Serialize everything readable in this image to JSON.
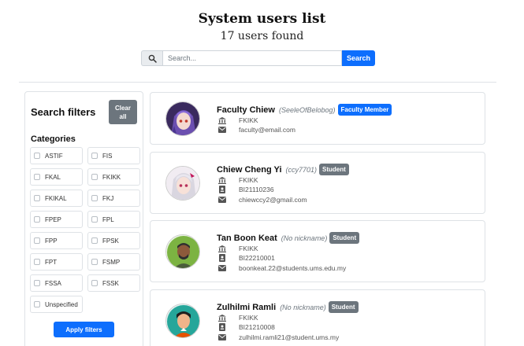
{
  "header": {
    "title": "System users list",
    "subtitle": "17 users found"
  },
  "search": {
    "placeholder": "Search...",
    "value": "",
    "button_label": "Search",
    "icon": "search-icon"
  },
  "filters": {
    "title": "Search filters",
    "clear_label_line1": "Clear",
    "clear_label_line2": "all",
    "categories_label": "Categories",
    "categories": [
      "ASTIF",
      "FIS",
      "FKAL",
      "FKIKK",
      "FKIKAL",
      "FKJ",
      "FPEP",
      "FPL",
      "FPP",
      "FPSK",
      "FPT",
      "FSMP",
      "FSSA",
      "FSSK",
      "Unspecified"
    ],
    "apply_label": "Apply filters"
  },
  "users": [
    {
      "name": "Faculty Chiew",
      "nickname": "(SeeleOfBelobog)",
      "role": "Faculty Member",
      "role_color": "#0d6efd",
      "faculty": "FKIKK",
      "id_number": "",
      "email": "faculty@email.com",
      "avatar": "anime-avatar-purple"
    },
    {
      "name": "Chiew Cheng Yi",
      "nickname": "(ccy7701)",
      "role": "Student",
      "role_color": "#6c757d",
      "faculty": "FKIKK",
      "id_number": "BI21110236",
      "email": "chiewccy2@gmail.com",
      "avatar": "anime-avatar-silver"
    },
    {
      "name": "Tan Boon Keat",
      "nickname": "(No nickname)",
      "role": "Student",
      "role_color": "#6c757d",
      "faculty": "FKIKK",
      "id_number": "BI22210001",
      "email": "boonkeat.22@students.ums.edu.my",
      "avatar": "default-avatar-green"
    },
    {
      "name": "Zulhilmi Ramli",
      "nickname": "(No nickname)",
      "role": "Student",
      "role_color": "#6c757d",
      "faculty": "FKIKK",
      "id_number": "BI21210008",
      "email": "zulhilmi.ramli21@student.ums.my",
      "avatar": "default-avatar-teal"
    }
  ],
  "colors": {
    "primary": "#0d6efd",
    "secondary": "#6c757d",
    "border": "#dee2e6"
  }
}
